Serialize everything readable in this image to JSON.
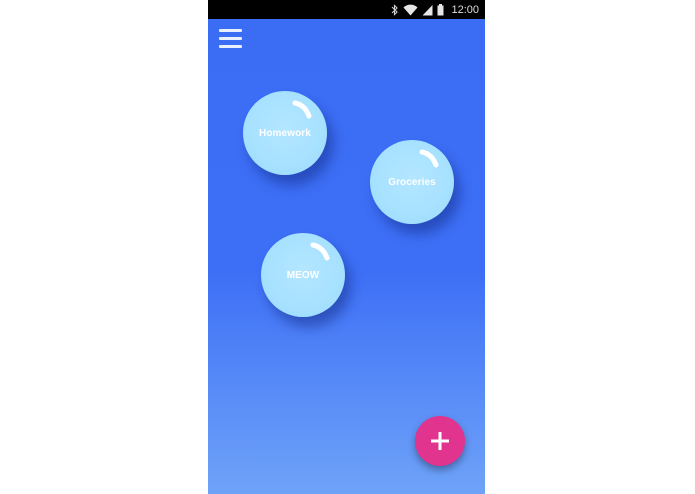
{
  "status_bar": {
    "time": "12:00",
    "icons": [
      "bluetooth-icon",
      "wifi-icon",
      "signal-icon",
      "battery-icon"
    ]
  },
  "menu": {
    "icon": "hamburger-menu-icon"
  },
  "bubbles": [
    {
      "label": "Homework"
    },
    {
      "label": "Groceries"
    },
    {
      "label": "MEOW"
    }
  ],
  "fab": {
    "icon": "plus-icon"
  },
  "colors": {
    "background_top": "#3a6cf4",
    "background_bottom": "#6ea3f8",
    "bubble": "#a6e1ff",
    "fab": "#e0348f"
  }
}
